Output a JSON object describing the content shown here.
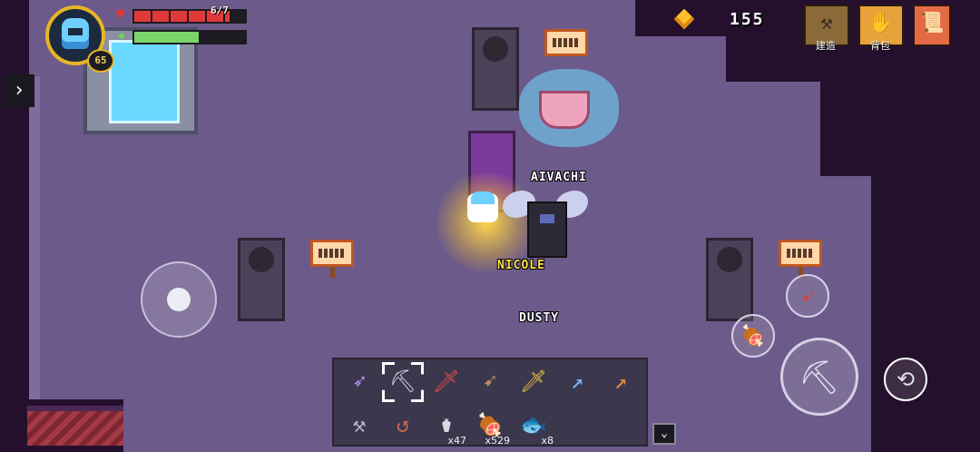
{
  "hud": {
    "level": "65",
    "hp_text": "6/7",
    "hp_fraction": 0.86,
    "energy_fraction": 0.58,
    "side_toggle_icon": "chevron-right-icon"
  },
  "currency": {
    "icon": "gem-icon",
    "amount": "155"
  },
  "top_buttons": [
    {
      "icon": "anvil-icon",
      "label": "建造"
    },
    {
      "icon": "backpack-icon",
      "label": "背包"
    },
    {
      "icon": "scroll-icon",
      "label": ""
    }
  ],
  "players": [
    {
      "name": "AIVACHI"
    },
    {
      "name": "NICOLE"
    },
    {
      "name": "DUSTY"
    }
  ],
  "hotbar": {
    "row1": [
      {
        "icon": "crossbow-icon",
        "glyph": "➶",
        "color": "#b98cf0",
        "count": ""
      },
      {
        "icon": "shovel-icon",
        "glyph": "⛏",
        "color": "#cfd4e0",
        "count": "",
        "selected": true
      },
      {
        "icon": "red-sword-icon",
        "glyph": "🗡",
        "color": "#e0504a",
        "count": ""
      },
      {
        "icon": "bow-icon",
        "glyph": "➹",
        "color": "#c08a6a",
        "count": ""
      },
      {
        "icon": "golden-sword-icon",
        "glyph": "🗡",
        "color": "#f0c040",
        "count": ""
      },
      {
        "icon": "ice-spear-icon",
        "glyph": "↗",
        "color": "#7ab8ff",
        "count": ""
      },
      {
        "icon": "fire-staff-icon",
        "glyph": "↗",
        "color": "#f08a3a",
        "count": ""
      }
    ],
    "row2": [
      {
        "icon": "hammer-icon",
        "glyph": "⚒",
        "color": "#b0b4c4",
        "count": ""
      },
      {
        "icon": "fishing-rod-icon",
        "glyph": "↺",
        "color": "#c46a5a",
        "count": ""
      },
      {
        "icon": "jar-icon",
        "glyph": "⚱",
        "color": "#d8d8e0",
        "count": "x47"
      },
      {
        "icon": "meat-icon",
        "glyph": "🍖",
        "color": "#c86a3a",
        "count": "x529"
      },
      {
        "icon": "fish-icon",
        "glyph": "🐟",
        "color": "#4a8ae0",
        "count": "x8"
      }
    ],
    "expand_icon": "chevron-down-icon"
  },
  "controls": {
    "joystick_icon": "joystick-knob",
    "bow_icon": "bow-icon",
    "food_icon": "meat-icon",
    "attack_icon": "shovel-icon",
    "dodge_icon": "dodge-roll-icon"
  }
}
